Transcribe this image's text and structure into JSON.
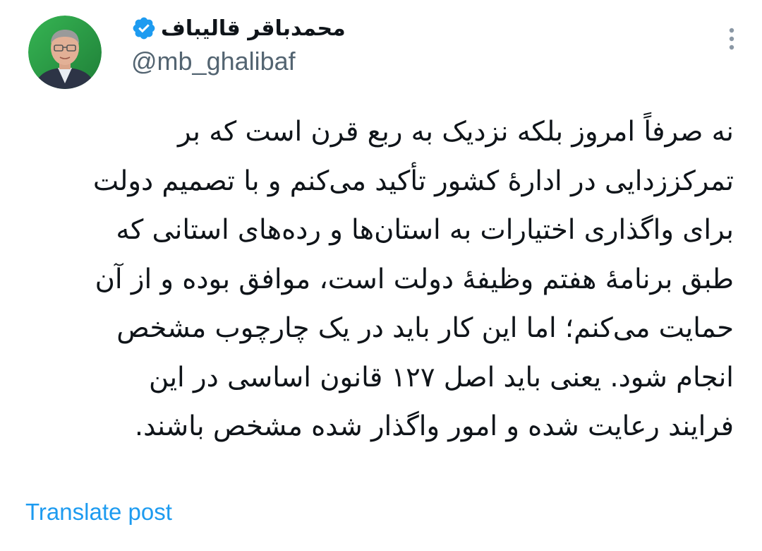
{
  "author": {
    "display_name": "محمدباقر قالیباف",
    "handle": "@mb_ghalibaf",
    "verified": true,
    "avatar_icon": "profile-photo",
    "verified_icon": "verified-badge-icon"
  },
  "tweet": {
    "lines": [
      "نه صرفاً امروز بلکه نزدیک به ربع قرن است که بر",
      "تمرکززدایی در ادارهٔ کشور تأکید می‌کنم و با تصمیم دولت",
      "برای واگذاری اختیارات به استان‌ها و رده‌های استانی که",
      "طبق برنامهٔ هفتم وظیفهٔ دولت است، موافق بوده و از آن",
      "حمایت می‌کنم؛ اما این کار باید در یک چارچوب مشخص",
      "انجام شود. یعنی باید اصل ۱۲۷ قانون اساسی در این",
      "فرایند رعایت شده و امور واگذار شده مشخص باشند."
    ]
  },
  "actions": {
    "translate_label": "Translate post",
    "menu_icon": "more-vertical-icon"
  },
  "colors": {
    "text": "#0f1419",
    "secondary": "#536471",
    "accent": "#1d9bf0",
    "avatar_ring": "#2e9e48"
  }
}
